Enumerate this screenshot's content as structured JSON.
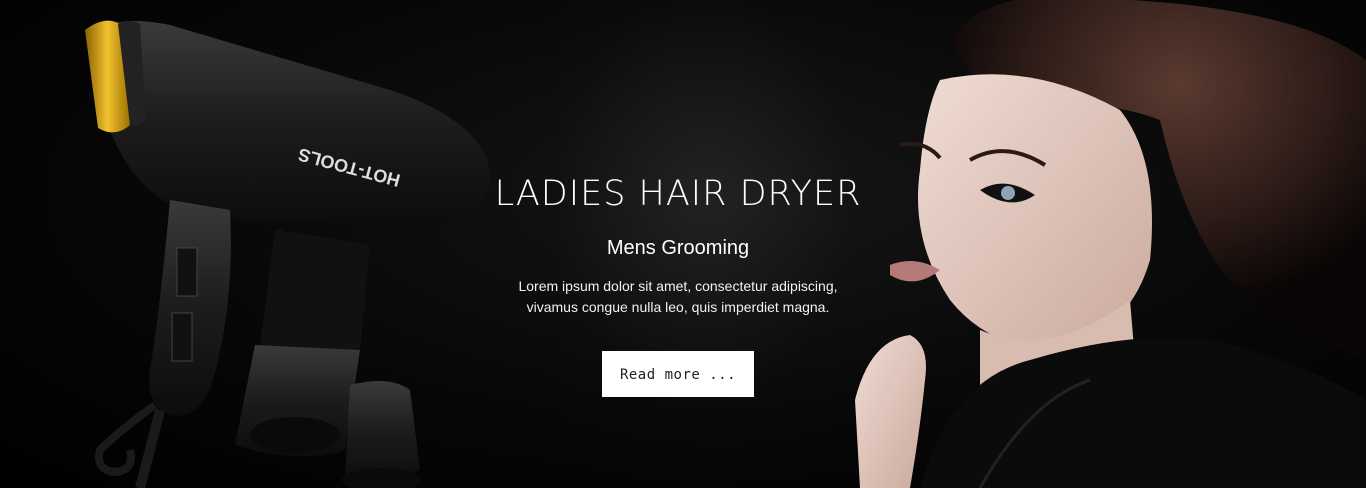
{
  "slide": {
    "title": "LADIES HAIR DRYER",
    "subtitle": "Mens Grooming",
    "description_line1": "Lorem ipsum dolor sit amet, consectetur adipiscing,",
    "description_line2": "vivamus congue nulla leo, quis imperdiet magna.",
    "button_label": "Read more ...",
    "product_brand_text": "HOT-TOOLS"
  },
  "colors": {
    "background": "#000000",
    "button_bg": "#ffffff",
    "text": "#ffffff",
    "accent_gold": "#d4a017"
  }
}
